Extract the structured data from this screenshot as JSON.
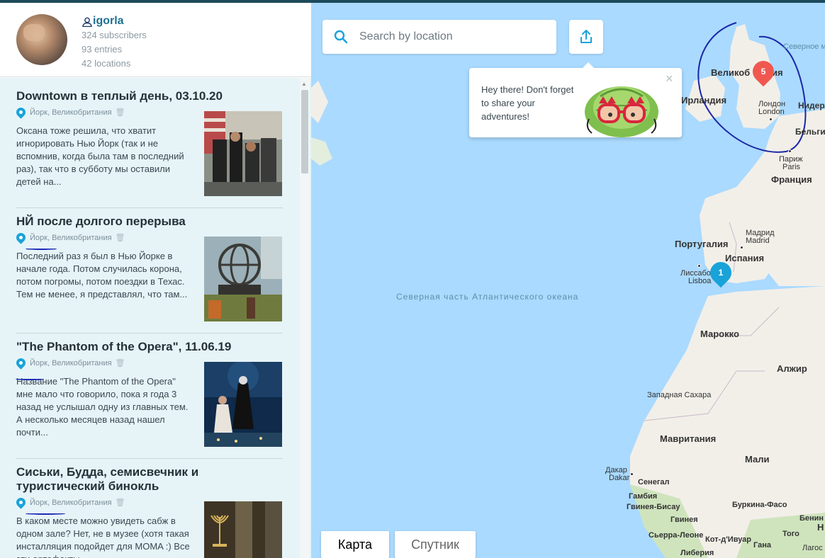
{
  "profile": {
    "username": "igorla",
    "subscribers": "324 subscribers",
    "entries": "93 entries",
    "locations": "42 locations"
  },
  "entries": [
    {
      "title": "Downtown в теплый день, 03.10.20",
      "location": "Йорк, Великобритания",
      "text": "Оксана тоже решила, что хватит игнорировать Нью Йорк (так и не вспомнив, когда была там в последний раз), так что в субботу мы оставили детей на..."
    },
    {
      "title": "НЙ после долгого перерыва",
      "location": "Йорк, Великобритания",
      "text": "Последний раз я был в Нью Йорке в начале года. Потом случилась корона, потом погромы, потом поездки в Техас. Тем не менее, я представлял, что там..."
    },
    {
      "title": "\"The Phantom of the Opera\", 11.06.19",
      "location": "Йорк, Великобритания",
      "text": "Название \"The Phantom of the Opera\" мне мало что говорило, пока я года 3 назад не услышал одну из главных тем. А несколько месяцев назад нашел почти..."
    },
    {
      "title": "Сиськи, Будда, семисвечник и туристический бинокль",
      "location": "Йорк, Великобритания",
      "text": "В каком месте можно увидеть сабж в одном зале? Нет, не в музее (хотя такая инсталляция подойдет для MOMA :) Все эти артефакты..."
    }
  ],
  "map": {
    "search_placeholder": "Search by location",
    "tooltip_text": "Hey there! Don't forget to share your adventures!",
    "tooltip_close": "×",
    "tab_map": "Карта",
    "tab_satellite": "Спутник",
    "markers": [
      {
        "count": "5",
        "color": "#f0584f"
      },
      {
        "count": "1",
        "color": "#1aa3d9"
      }
    ],
    "labels": {
      "uk": "Великобритания",
      "uk_vis": "Великоб",
      "ireland": "Ирландия",
      "london": "Лондон",
      "london_en": "London",
      "north_sea": "Северное море",
      "netherlands": "Нидерл",
      "belgium": "Бельгия",
      "paris": "Париж",
      "paris_en": "Paris",
      "france": "Франция",
      "madrid": "Мадрид",
      "madrid_en": "Madrid",
      "portugal": "Португалия",
      "spain": "Испания",
      "lisbon": "Лиссабон",
      "lisbon_en": "Lisboa",
      "atlantic": "Северная часть Атлантического океана",
      "morocco": "Марокко",
      "algeria": "Алжир",
      "western_sahara": "Западная Сахара",
      "mauritania": "Мавритания",
      "mali": "Мали",
      "dakar": "Дакар",
      "dakar_en": "Dakar",
      "senegal": "Сенегал",
      "gambia": "Гамбия",
      "guinea_bissau": "Гвинея-Бисау",
      "guinea": "Гвинея",
      "sierra_leone": "Сьерра-Леоне",
      "ivory_coast": "Кот-д'Ивуар",
      "liberia": "Либерия",
      "burkina": "Буркина-Фасо",
      "ghana": "Гана",
      "togo": "Того",
      "benin": "Бенин",
      "lagos": "Лагос",
      "n_cut": "Н"
    }
  }
}
